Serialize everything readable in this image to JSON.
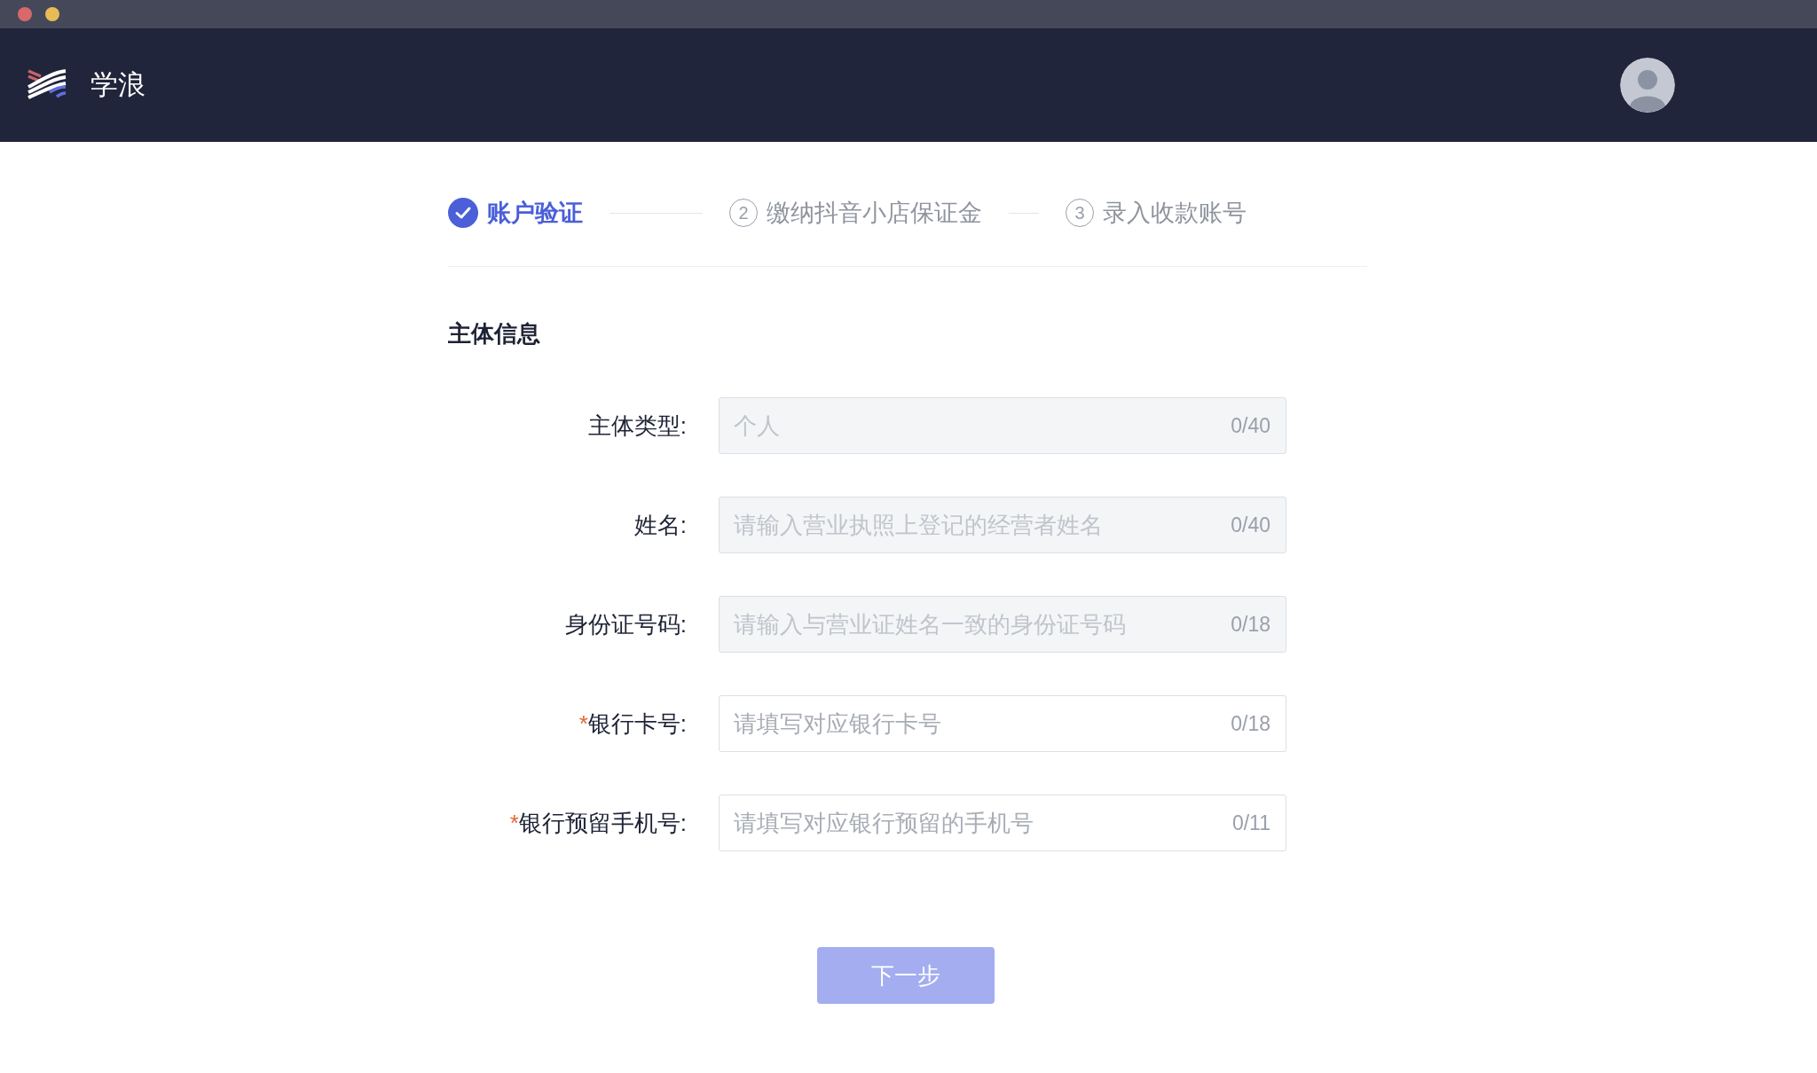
{
  "app": {
    "name": "学浪"
  },
  "steps": [
    {
      "label": "账户验证",
      "completed": true
    },
    {
      "number": "2",
      "label": "缴纳抖音小店保证金",
      "completed": false
    },
    {
      "number": "3",
      "label": "录入收款账号",
      "completed": false
    }
  ],
  "section_title": "主体信息",
  "fields": [
    {
      "label": "主体类型:",
      "disabled": true,
      "placeholder": "个人",
      "counter": "0/40"
    },
    {
      "label": "姓名:",
      "disabled": true,
      "placeholder": "请输入营业执照上登记的经营者姓名",
      "counter": "0/40"
    },
    {
      "label": "身份证号码:",
      "disabled": true,
      "placeholder": "请输入与营业证姓名一致的身份证号码",
      "counter": "0/18"
    },
    {
      "required_mark": "*",
      "label": "银行卡号:",
      "disabled": false,
      "placeholder": "请填写对应银行卡号",
      "counter": "0/18"
    },
    {
      "required_mark": "*",
      "label": "银行预留手机号:",
      "disabled": false,
      "placeholder": "请填写对应银行预留的手机号",
      "counter": "0/11"
    }
  ],
  "next_button": {
    "label": "下一步",
    "disabled": true
  }
}
